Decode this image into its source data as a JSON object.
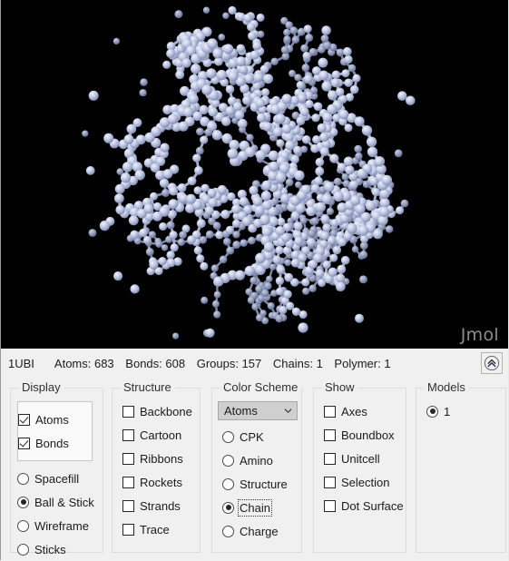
{
  "viewport": {
    "watermark": "Jmol",
    "background_color": "#000000",
    "atom_color": "#b9c2e0",
    "bond_color": "#c7cfe8"
  },
  "statusbar": {
    "structure_id": "1UBI",
    "metrics": [
      "Atoms: 683",
      "Bonds: 608",
      "Groups: 157",
      "Chains: 1",
      "Polymer: 1"
    ],
    "expand_button_icon": "double-chevron-up-icon"
  },
  "panels": {
    "display": {
      "legend": "Display",
      "checkboxes": [
        {
          "label": "Atoms",
          "checked": true
        },
        {
          "label": "Bonds",
          "checked": true
        }
      ],
      "radios": [
        {
          "label": "Spacefill",
          "selected": false
        },
        {
          "label": "Ball & Stick",
          "selected": true
        },
        {
          "label": "Wireframe",
          "selected": false
        },
        {
          "label": "Sticks",
          "selected": false
        }
      ]
    },
    "structure": {
      "legend": "Structure",
      "checkboxes": [
        {
          "label": "Backbone",
          "checked": false
        },
        {
          "label": "Cartoon",
          "checked": false
        },
        {
          "label": "Ribbons",
          "checked": false
        },
        {
          "label": "Rockets",
          "checked": false
        },
        {
          "label": "Strands",
          "checked": false
        },
        {
          "label": "Trace",
          "checked": false
        }
      ]
    },
    "color_scheme": {
      "legend": "Color Scheme",
      "select": {
        "value": "Atoms",
        "icon": "chevron-down-icon"
      },
      "radios": [
        {
          "label": "CPK",
          "selected": false,
          "focused": false
        },
        {
          "label": "Amino",
          "selected": false,
          "focused": false
        },
        {
          "label": "Structure",
          "selected": false,
          "focused": false
        },
        {
          "label": "Chain",
          "selected": true,
          "focused": true
        },
        {
          "label": "Charge",
          "selected": false,
          "focused": false
        }
      ]
    },
    "show": {
      "legend": "Show",
      "checkboxes": [
        {
          "label": "Axes",
          "checked": false
        },
        {
          "label": "Boundbox",
          "checked": false
        },
        {
          "label": "Unitcell",
          "checked": false
        },
        {
          "label": "Selection",
          "checked": false
        },
        {
          "label": "Dot Surface",
          "checked": false
        }
      ]
    },
    "models": {
      "legend": "Models",
      "radios": [
        {
          "label": "1",
          "selected": true
        }
      ]
    }
  }
}
